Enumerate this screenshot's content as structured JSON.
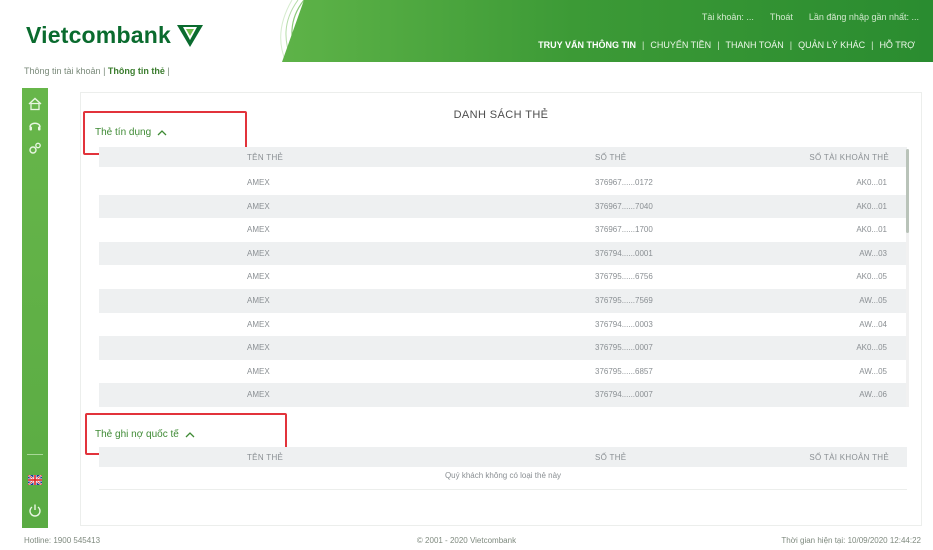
{
  "header": {
    "logo_text": "Vietcombank",
    "top_info": {
      "greeting": "Tài khoản: ...",
      "exit": "Thoát",
      "last_login": "Lần đăng nhập gần nhất: ..."
    },
    "nav": [
      {
        "label": "TRUY VẤN THÔNG TIN",
        "active": true
      },
      {
        "label": "CHUYỂN TIỀN",
        "active": false
      },
      {
        "label": "THANH TOÁN",
        "active": false
      },
      {
        "label": "QUẢN LÝ KHÁC",
        "active": false
      },
      {
        "label": "HỖ TRỢ",
        "active": false
      }
    ]
  },
  "breadcrumb": {
    "parent": "Thông tin tài khoản",
    "current": "Thông tin thẻ"
  },
  "sidebar": {
    "icons": [
      "home-icon",
      "headset-icon",
      "gears-icon"
    ],
    "bottom_icons": [
      "uk-flag-icon",
      "power-icon"
    ]
  },
  "page": {
    "title": "DANH SÁCH THẺ",
    "active_cards": {
      "heading": "Thẻ tín dụng",
      "headers": {
        "name": "TÊN THẺ",
        "number": "SỐ THẺ",
        "account": "SỐ TÀI KHOẢN THẺ"
      },
      "rows": [
        {
          "name": "AMEX",
          "number": "376967......0172",
          "account": "AK0...01"
        },
        {
          "name": "AMEX",
          "number": "376967......7040",
          "account": "AK0...01"
        },
        {
          "name": "AMEX",
          "number": "376967......1700",
          "account": "AK0...01"
        },
        {
          "name": "AMEX",
          "number": "376794......0001",
          "account": "AW...03"
        },
        {
          "name": "AMEX",
          "number": "376795......6756",
          "account": "AK0...05"
        },
        {
          "name": "AMEX",
          "number": "376795......7569",
          "account": "AW...05"
        },
        {
          "name": "AMEX",
          "number": "376794......0003",
          "account": "AW...04"
        },
        {
          "name": "AMEX",
          "number": "376795......0007",
          "account": "AK0...05"
        },
        {
          "name": "AMEX",
          "number": "376795......6857",
          "account": "AW...05"
        },
        {
          "name": "AMEX",
          "number": "376794......0007",
          "account": "AW...06"
        }
      ]
    },
    "international_cards": {
      "heading": "Thẻ ghi nợ quốc tế",
      "headers": {
        "name": "TÊN THẺ",
        "number": "SỐ THẺ",
        "account": "SỐ TÀI KHOẢN THẺ"
      },
      "empty_message": "Quý khách không có loại thẻ này"
    }
  },
  "footer": {
    "hotline": "Hotline: 1900 545413",
    "copyright": "© 2001 - 2020 Vietcombank",
    "last_login": "Thời gian hiện tại: 10/09/2020 12:44:22"
  },
  "colors": {
    "brand_green": "#0a6b2e",
    "nav_green": "#3c9a36",
    "sidebar_green": "#5aab43",
    "highlight_red": "#e2333b"
  }
}
